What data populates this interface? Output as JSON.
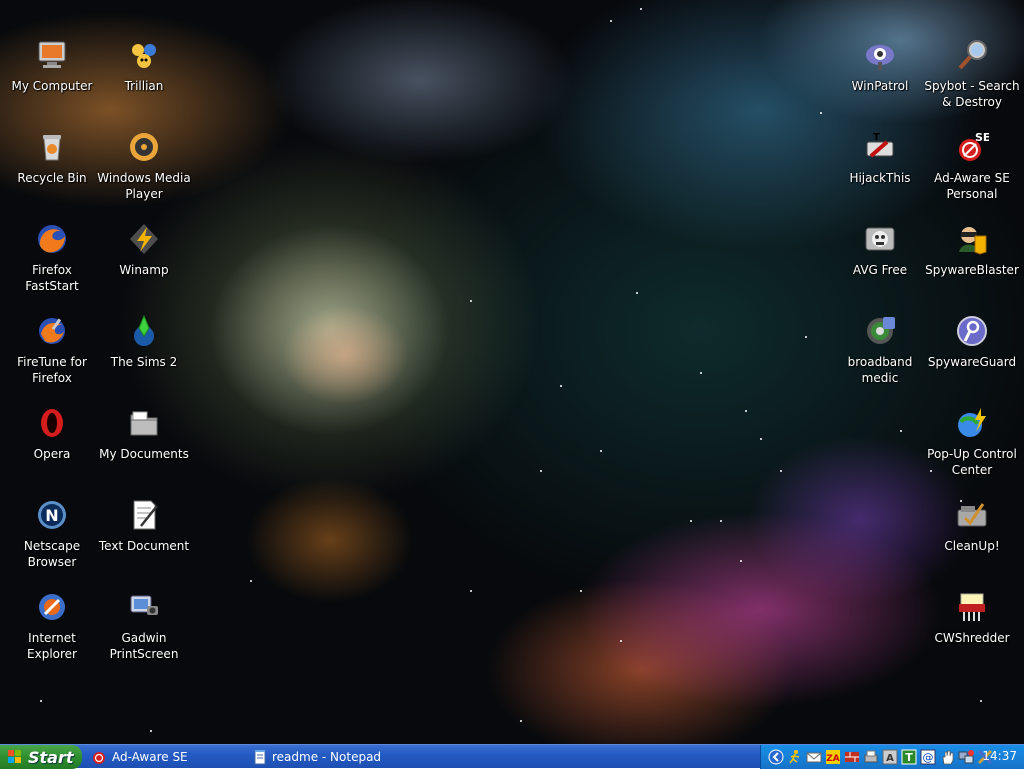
{
  "desktop": {
    "left_icons": [
      {
        "label": "My Computer",
        "icon": "computer-icon"
      },
      {
        "label": "Trillian",
        "icon": "trillian-icon"
      },
      {
        "label": "Recycle Bin",
        "icon": "recycle-bin-icon"
      },
      {
        "label": "Windows Media\nPlayer",
        "icon": "media-player-icon"
      },
      {
        "label": "Firefox\nFastStart",
        "icon": "firefox-icon"
      },
      {
        "label": "Winamp",
        "icon": "winamp-icon"
      },
      {
        "label": "FireTune for\nFirefox",
        "icon": "firetune-icon"
      },
      {
        "label": "The Sims 2",
        "icon": "sims-icon"
      },
      {
        "label": "Opera",
        "icon": "opera-icon"
      },
      {
        "label": "My Documents",
        "icon": "folder-icon"
      },
      {
        "label": "Netscape\nBrowser",
        "icon": "netscape-icon"
      },
      {
        "label": "Text Document",
        "icon": "text-document-icon"
      },
      {
        "label": "Internet\nExplorer",
        "icon": "internet-explorer-icon"
      },
      {
        "label": "Gadwin\nPrintScreen",
        "icon": "printscreen-icon"
      }
    ],
    "right_icons": [
      {
        "label": "WinPatrol",
        "icon": "winpatrol-icon"
      },
      {
        "label": "Spybot - Search\n& Destroy",
        "icon": "spybot-icon"
      },
      {
        "label": "HijackThis",
        "icon": "hijackthis-icon"
      },
      {
        "label": "Ad-Aware SE\nPersonal",
        "icon": "adaware-icon"
      },
      {
        "label": "AVG Free",
        "icon": "avg-icon"
      },
      {
        "label": "SpywareBlaster",
        "icon": "spywareblaster-icon"
      },
      {
        "label": "broadband\nmedic",
        "icon": "broadband-medic-icon"
      },
      {
        "label": "SpywareGuard",
        "icon": "spywareguard-icon"
      },
      {
        "label": "Pop-Up Control\nCenter",
        "icon": "popup-control-icon"
      },
      {
        "label": "CleanUp!",
        "icon": "cleanup-icon"
      },
      {
        "label": "CWShredder",
        "icon": "shredder-icon"
      }
    ]
  },
  "taskbar": {
    "start_label": "Start",
    "tasks": [
      {
        "label": "Ad-Aware SE",
        "icon": "adaware-icon"
      },
      {
        "label": "readme - Notepad",
        "icon": "notepad-icon"
      }
    ],
    "tray_icons": [
      "collapse-arrow-icon",
      "running-man-icon",
      "mail-icon",
      "zonealarm-icon",
      "firewall-icon",
      "printer-icon",
      "text-a-icon",
      "t-icon",
      "email-at-icon",
      "hand-icon",
      "network-icon",
      "tools-icon"
    ],
    "clock": "14:37"
  },
  "colors": {
    "taskbar": "#245bc4",
    "start_button": "#2f8f2f",
    "tray": "#1a8ee6"
  }
}
